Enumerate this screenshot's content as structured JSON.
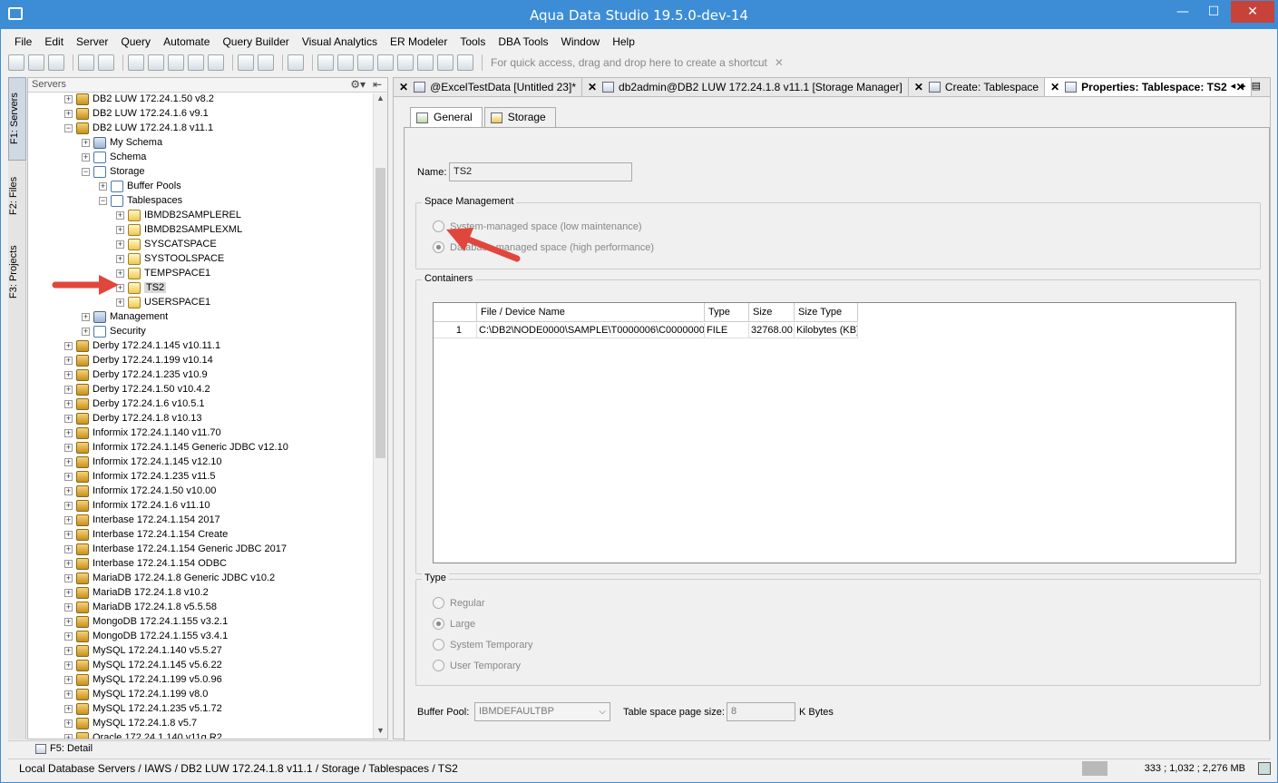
{
  "app": {
    "title": "Aqua Data Studio 19.5.0-dev-14"
  },
  "window_controls": {
    "minimize": "—",
    "maximize": "☐",
    "close": "✕"
  },
  "menu": [
    "File",
    "Edit",
    "Server",
    "Query",
    "Automate",
    "Query Builder",
    "Visual Analytics",
    "ER Modeler",
    "Tools",
    "DBA Tools",
    "Window",
    "Help"
  ],
  "toolbar": {
    "quick_access": "For quick access, drag and drop here to create a shortcut",
    "quick_close": "✕"
  },
  "side_tabs": {
    "servers": "F1: Servers",
    "files": "F2: Files",
    "projects": "F3: Projects"
  },
  "server_panel": {
    "title": "Servers",
    "gear": "⚙▾",
    "pin": "⇤",
    "tree": [
      {
        "label": "DB2 LUW 172.24.1.50 v8.2",
        "depth": 0,
        "icon": "db",
        "exp": "+"
      },
      {
        "label": "DB2 LUW 172.24.1.6 v9.1",
        "depth": 0,
        "icon": "db",
        "exp": "+"
      },
      {
        "label": "DB2 LUW 172.24.1.8 v11.1",
        "depth": 0,
        "icon": "db",
        "exp": "−"
      },
      {
        "label": "My Schema",
        "depth": 1,
        "icon": "schema",
        "exp": "+"
      },
      {
        "label": "Schema",
        "depth": 1,
        "icon": "folder",
        "exp": "+"
      },
      {
        "label": "Storage",
        "depth": 1,
        "icon": "folder",
        "exp": "−"
      },
      {
        "label": "Buffer Pools",
        "depth": 2,
        "icon": "folder",
        "exp": "+"
      },
      {
        "label": "Tablespaces",
        "depth": 2,
        "icon": "folder",
        "exp": "−"
      },
      {
        "label": "IBMDB2SAMPLEREL",
        "depth": 3,
        "icon": "table",
        "exp": "+"
      },
      {
        "label": "IBMDB2SAMPLEXML",
        "depth": 3,
        "icon": "table",
        "exp": "+"
      },
      {
        "label": "SYSCATSPACE",
        "depth": 3,
        "icon": "table",
        "exp": "+"
      },
      {
        "label": "SYSTOOLSPACE",
        "depth": 3,
        "icon": "table",
        "exp": "+"
      },
      {
        "label": "TEMPSPACE1",
        "depth": 3,
        "icon": "table",
        "exp": "+"
      },
      {
        "label": "TS2",
        "depth": 3,
        "icon": "table",
        "exp": "+",
        "selected": true
      },
      {
        "label": "USERSPACE1",
        "depth": 3,
        "icon": "table",
        "exp": "+"
      },
      {
        "label": "Management",
        "depth": 1,
        "icon": "schema",
        "exp": "+"
      },
      {
        "label": "Security",
        "depth": 1,
        "icon": "folder",
        "exp": "+"
      },
      {
        "label": "Derby 172.24.1.145 v10.11.1",
        "depth": 0,
        "icon": "db",
        "exp": "+"
      },
      {
        "label": "Derby 172.24.1.199 v10.14",
        "depth": 0,
        "icon": "db",
        "exp": "+"
      },
      {
        "label": "Derby 172.24.1.235 v10.9",
        "depth": 0,
        "icon": "db",
        "exp": "+"
      },
      {
        "label": "Derby 172.24.1.50 v10.4.2",
        "depth": 0,
        "icon": "db",
        "exp": "+"
      },
      {
        "label": "Derby 172.24.1.6 v10.5.1",
        "depth": 0,
        "icon": "db",
        "exp": "+"
      },
      {
        "label": "Derby 172.24.1.8 v10.13",
        "depth": 0,
        "icon": "db",
        "exp": "+"
      },
      {
        "label": "Informix 172.24.1.140 v11.70",
        "depth": 0,
        "icon": "db",
        "exp": "+"
      },
      {
        "label": "Informix 172.24.1.145 Generic JDBC v12.10",
        "depth": 0,
        "icon": "db",
        "exp": "+"
      },
      {
        "label": "Informix 172.24.1.145 v12.10",
        "depth": 0,
        "icon": "db",
        "exp": "+"
      },
      {
        "label": "Informix 172.24.1.235 v11.5",
        "depth": 0,
        "icon": "db",
        "exp": "+"
      },
      {
        "label": "Informix 172.24.1.50 v10.00",
        "depth": 0,
        "icon": "db",
        "exp": "+"
      },
      {
        "label": "Informix 172.24.1.6 v11.10",
        "depth": 0,
        "icon": "db",
        "exp": "+"
      },
      {
        "label": "Interbase 172.24.1.154 2017",
        "depth": 0,
        "icon": "db",
        "exp": "+"
      },
      {
        "label": "Interbase 172.24.1.154 Create",
        "depth": 0,
        "icon": "db",
        "exp": "+"
      },
      {
        "label": "Interbase 172.24.1.154 Generic JDBC 2017",
        "depth": 0,
        "icon": "db",
        "exp": "+"
      },
      {
        "label": "Interbase 172.24.1.154 ODBC",
        "depth": 0,
        "icon": "db",
        "exp": "+"
      },
      {
        "label": "MariaDB 172.24.1.8 Generic JDBC v10.2",
        "depth": 0,
        "icon": "db",
        "exp": "+"
      },
      {
        "label": "MariaDB 172.24.1.8 v10.2",
        "depth": 0,
        "icon": "db",
        "exp": "+"
      },
      {
        "label": "MariaDB 172.24.1.8 v5.5.58",
        "depth": 0,
        "icon": "db",
        "exp": "+"
      },
      {
        "label": "MongoDB 172.24.1.155 v3.2.1",
        "depth": 0,
        "icon": "db",
        "exp": "+"
      },
      {
        "label": "MongoDB 172.24.1.155 v3.4.1",
        "depth": 0,
        "icon": "db",
        "exp": "+"
      },
      {
        "label": "MySQL 172.24.1.140 v5.5.27",
        "depth": 0,
        "icon": "db",
        "exp": "+"
      },
      {
        "label": "MySQL 172.24.1.145 v5.6.22",
        "depth": 0,
        "icon": "db",
        "exp": "+"
      },
      {
        "label": "MySQL 172.24.1.199 v5.0.96",
        "depth": 0,
        "icon": "db",
        "exp": "+"
      },
      {
        "label": "MySQL 172.24.1.199 v8.0",
        "depth": 0,
        "icon": "db",
        "exp": "+"
      },
      {
        "label": "MySQL 172.24.1.235 v5.1.72",
        "depth": 0,
        "icon": "db",
        "exp": "+"
      },
      {
        "label": "MySQL 172.24.1.8 v5.7",
        "depth": 0,
        "icon": "db",
        "exp": "+"
      },
      {
        "label": "Oracle 172.24.1.140 v11g R2",
        "depth": 0,
        "icon": "db",
        "exp": "+"
      }
    ]
  },
  "editor_tabs": [
    {
      "label": "@ExcelTestData [Untitled 23]*",
      "active": false
    },
    {
      "label": "db2admin@DB2 LUW 172.24.1.8 v11.1 [Storage Manager]",
      "active": false
    },
    {
      "label": "Create: Tablespace",
      "active": false
    },
    {
      "label": "Properties: Tablespace: TS2",
      "active": true
    }
  ],
  "tab_nav": "◂▸▤",
  "subtabs": [
    "General",
    "Storage"
  ],
  "form": {
    "name_label": "Name:",
    "name_value": "TS2",
    "space_mgmt_title": "Space Management",
    "space_options": [
      "System-managed space (low maintenance)",
      "Database-managed space (high performance)"
    ],
    "space_selected": 1,
    "containers_title": "Containers",
    "columns": [
      "File / Device Name",
      "Type",
      "Size",
      "Size Type"
    ],
    "rows": [
      {
        "num": "1",
        "file": "C:\\DB2\\NODE0000\\SAMPLE\\T0000006\\C0000000...",
        "type": "FILE",
        "size": "32768.00",
        "size_type": "Kilobytes (KB)"
      }
    ],
    "type_title": "Type",
    "type_options": [
      "Regular",
      "Large",
      "System Temporary",
      "User Temporary"
    ],
    "type_selected": 1,
    "buffer_pool_label": "Buffer Pool:",
    "buffer_pool_value": "IBMDEFAULTBP",
    "page_size_label": "Table space page size:",
    "page_size_value": "8",
    "page_size_unit": "K Bytes"
  },
  "bottom_tab": "F5: Detail",
  "status": {
    "path": "Local Database Servers / IAWS / DB2 LUW 172.24.1.8 v11.1 / Storage / Tablespaces / TS2",
    "memory": "333 ; 1,032 ; 2,276 MB"
  },
  "colors": {
    "titlebar": "#3c8dd6",
    "close": "#c7433a",
    "arrow": "#e0463c"
  }
}
